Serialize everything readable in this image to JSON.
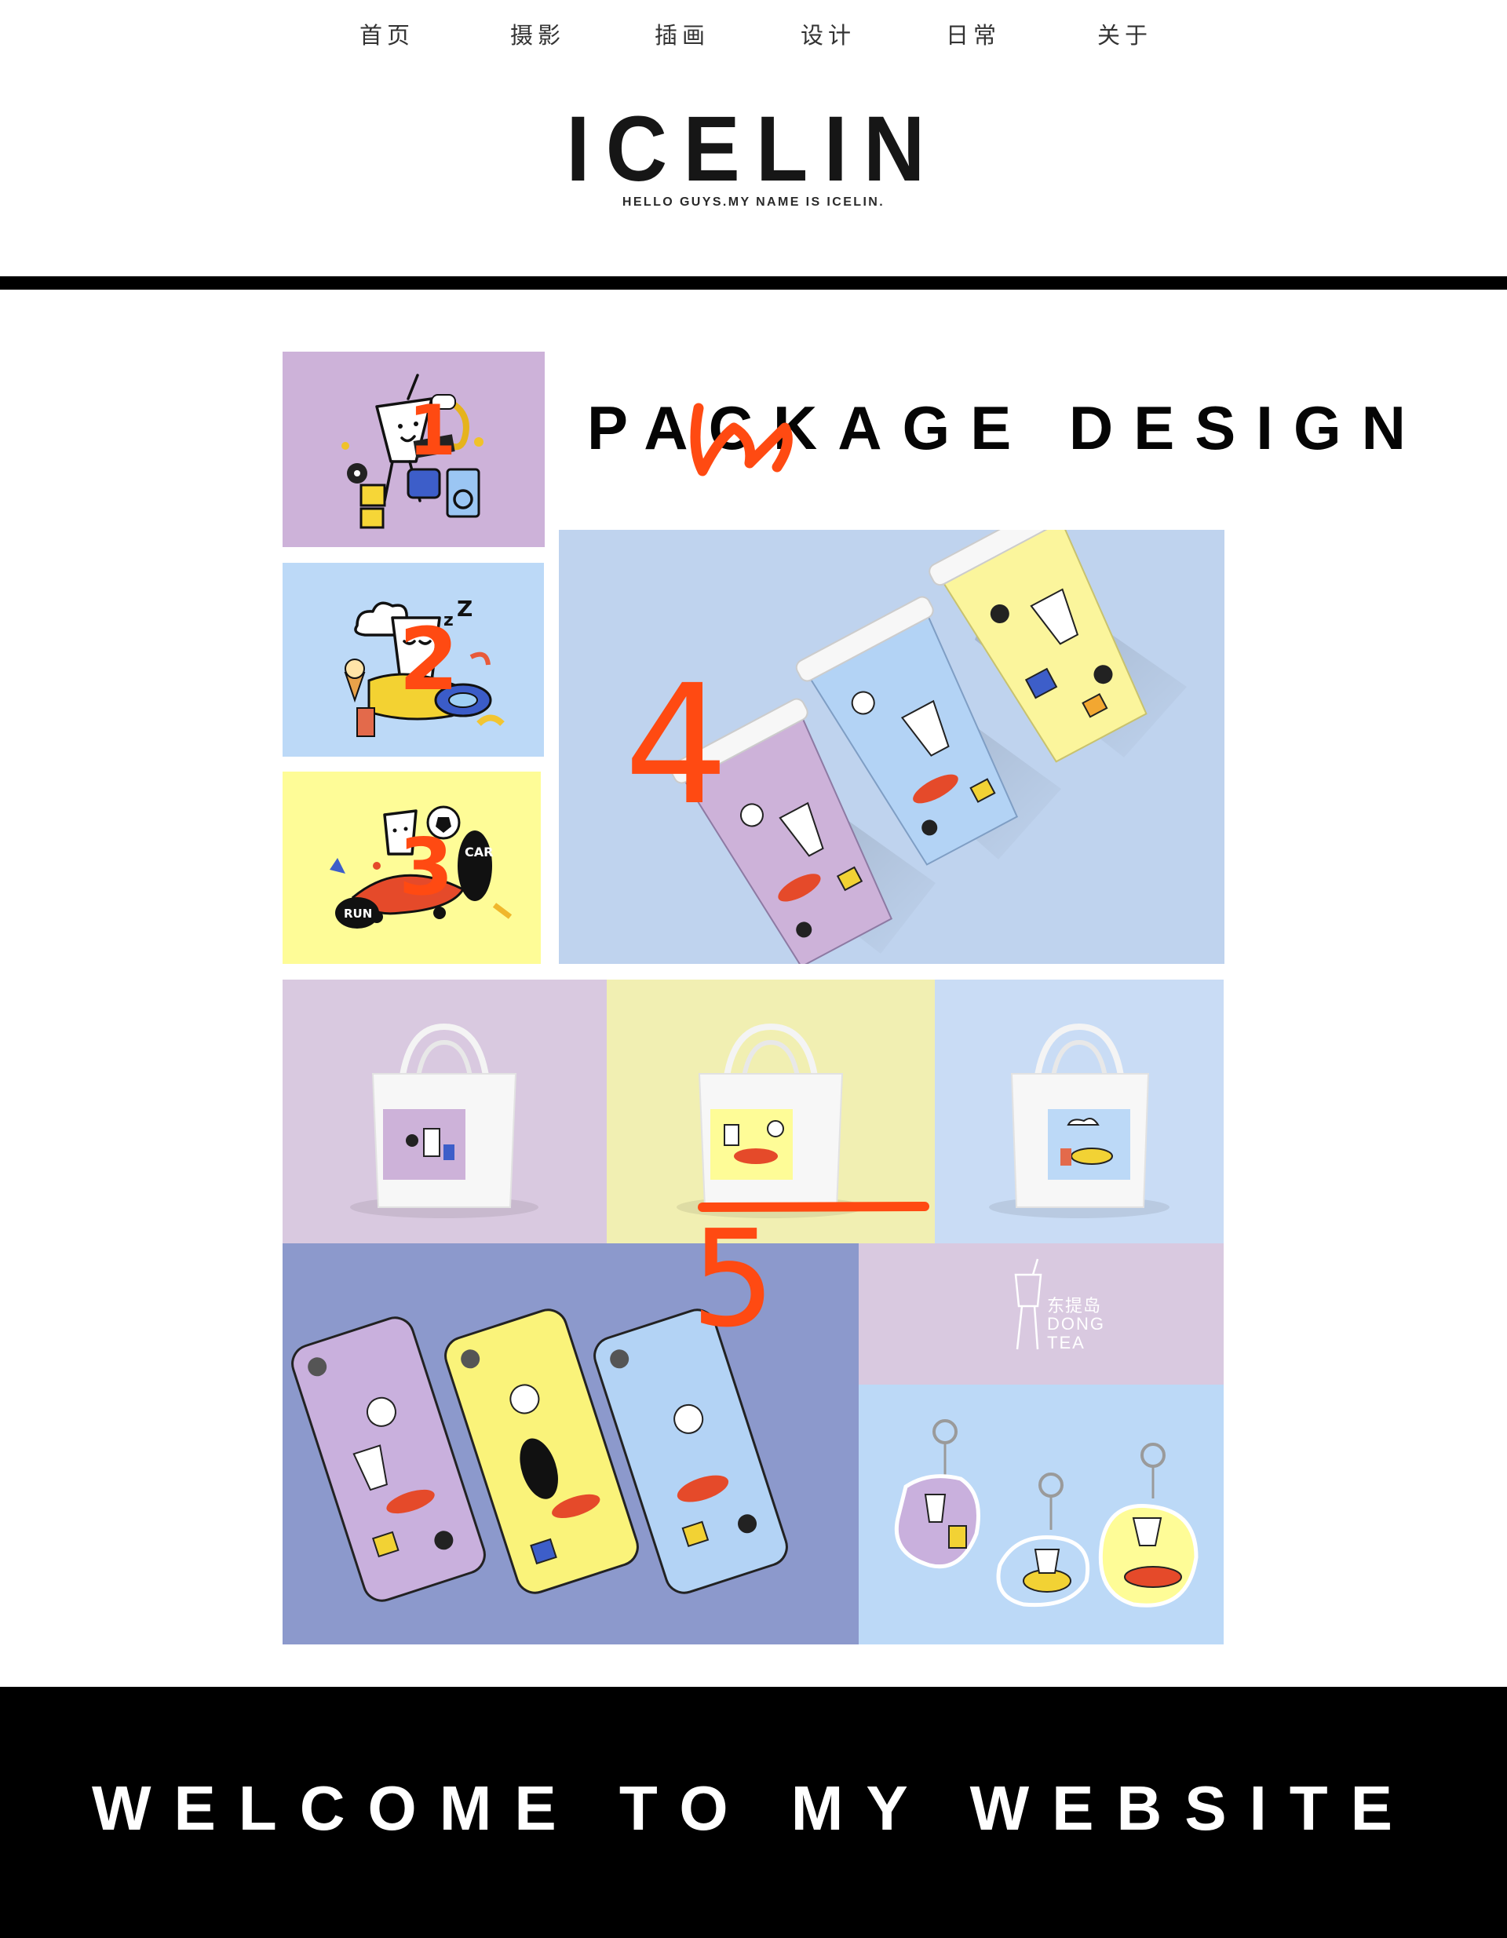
{
  "nav": {
    "items": [
      {
        "label": "首页"
      },
      {
        "label": "摄影"
      },
      {
        "label": "插画"
      },
      {
        "label": "设计"
      },
      {
        "label": "日常"
      },
      {
        "label": "关于"
      }
    ]
  },
  "logo": {
    "title": "ICELIN",
    "subtitle": "HELLO GUYS.MY NAME IS ICELIN."
  },
  "section": {
    "title": "PACKAGE DESIGN"
  },
  "brand_mark": {
    "cn": "东提岛",
    "en_line1": "DONG",
    "en_line2": "TEA"
  },
  "annotations": [
    "1",
    "2",
    "3",
    "4",
    "5"
  ],
  "footer": {
    "text": "WELCOME TO MY WEBSITE"
  },
  "colors": {
    "lavender": "#cdb2d9",
    "sky": "#bcd9f7",
    "lemon": "#fefc97",
    "cups_bg": "#bfd3ee",
    "periwinkle": "#8c99cc",
    "annotation": "#ff4a12"
  }
}
